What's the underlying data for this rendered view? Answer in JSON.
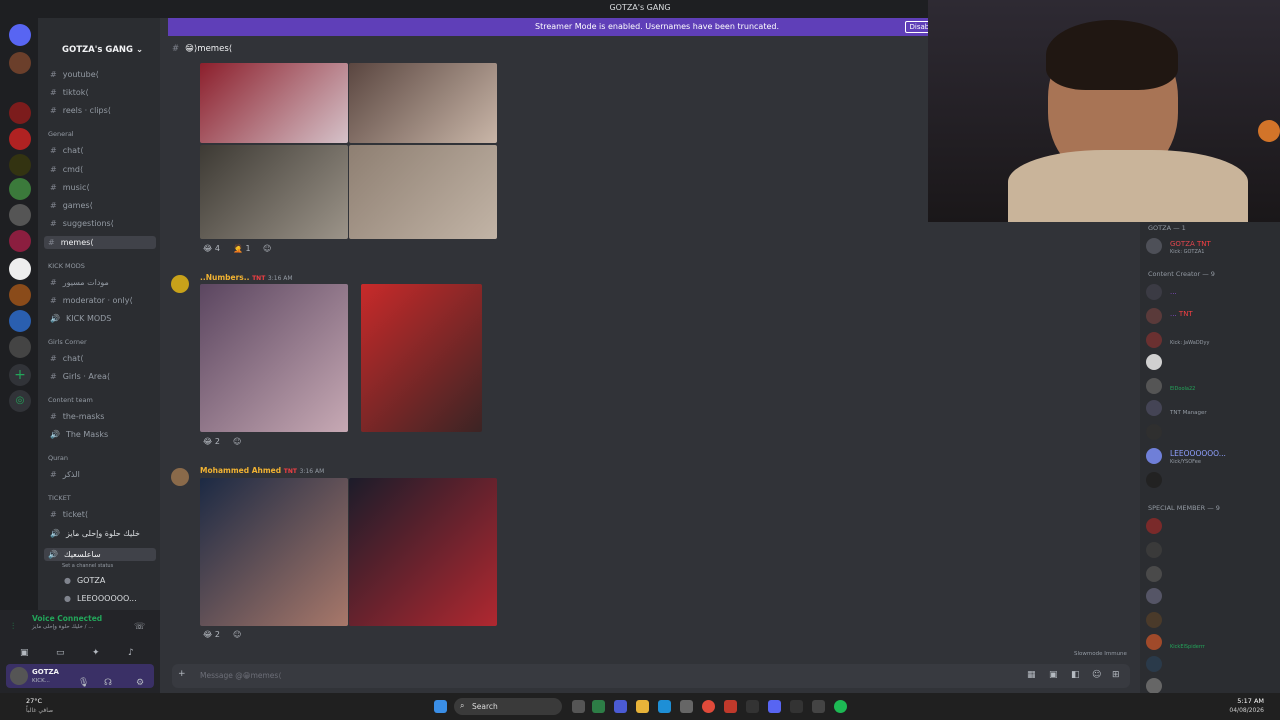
{
  "window": {
    "title": "GOTZA's GANG"
  },
  "banner": {
    "message": "Streamer Mode is enabled. Usernames have been truncated.",
    "disable_label": "Disable"
  },
  "server": {
    "name": "GOTZA's GANG ⌄"
  },
  "channel_header": "😁⟩memes⟨",
  "sidebar": {
    "channels": [
      "youtube⟨",
      "tiktok⟨",
      "reels · clips⟨",
      "chat⟨",
      "cmd⟨",
      "music⟨",
      "games⟨",
      "suggestions⟨",
      "memes⟨",
      "مودات مسيور",
      "moderator · only⟨",
      "KICK MODS",
      "chat⟨",
      "Girls · Area⟨",
      "the-masks",
      "The Masks",
      "الذكر",
      "ticket⟨",
      "خليك حلوة وإحلى مايز",
      "ساعلسعيك"
    ],
    "categories": [
      "General",
      "KICK MODS",
      "Girls Corner",
      "Content team",
      "Quran",
      "TICKET"
    ],
    "voice_users": [
      "GOTZA",
      "LEEOOOOOO..."
    ],
    "channel_status_hint": "Set a channel status"
  },
  "voice": {
    "status": "Voice Connected",
    "channel": "خليك حلوة وإحلى مايز / ..."
  },
  "user": {
    "name": "GOTZA",
    "status": "KICK..."
  },
  "messages": [
    {
      "reactions": [
        "4",
        "1"
      ]
    },
    {
      "author": "..Numbers..",
      "badge": "TNT",
      "time": "3:16 AM",
      "reactions": [
        "2"
      ]
    },
    {
      "author": "Mohammed Ahmed",
      "badge": "TNT",
      "time": "3:16 AM",
      "reactions": [
        "2"
      ]
    }
  ],
  "composer": {
    "placeholder": "Message @😁memes⟨",
    "slowmode": "Slowmode Immune"
  },
  "members": {
    "groups": [
      {
        "header": "GOTZA — 1",
        "names": [
          "GOTZA"
        ]
      },
      {
        "header": "Content Creator — 9",
        "names": [
          "...",
          "...",
          "TNT Manager",
          "...",
          "LEEOOOOOO..."
        ]
      },
      {
        "header": "SPECIAL MEMBER — 9",
        "names": [
          "...",
          "...",
          "...",
          "...",
          "...",
          "..."
        ]
      }
    ],
    "tags": [
      "TNT",
      "Kick: GOTZA1",
      "Kick: JaWaDDyy",
      "ElDoola22",
      "Kick/YSOFee",
      "KickElSpiderrr"
    ]
  },
  "taskbar": {
    "search": "Search",
    "time": "5:17 AM",
    "date": "04/08/2026",
    "weather": "27°C",
    "weather_desc": "صافي غالباً"
  }
}
